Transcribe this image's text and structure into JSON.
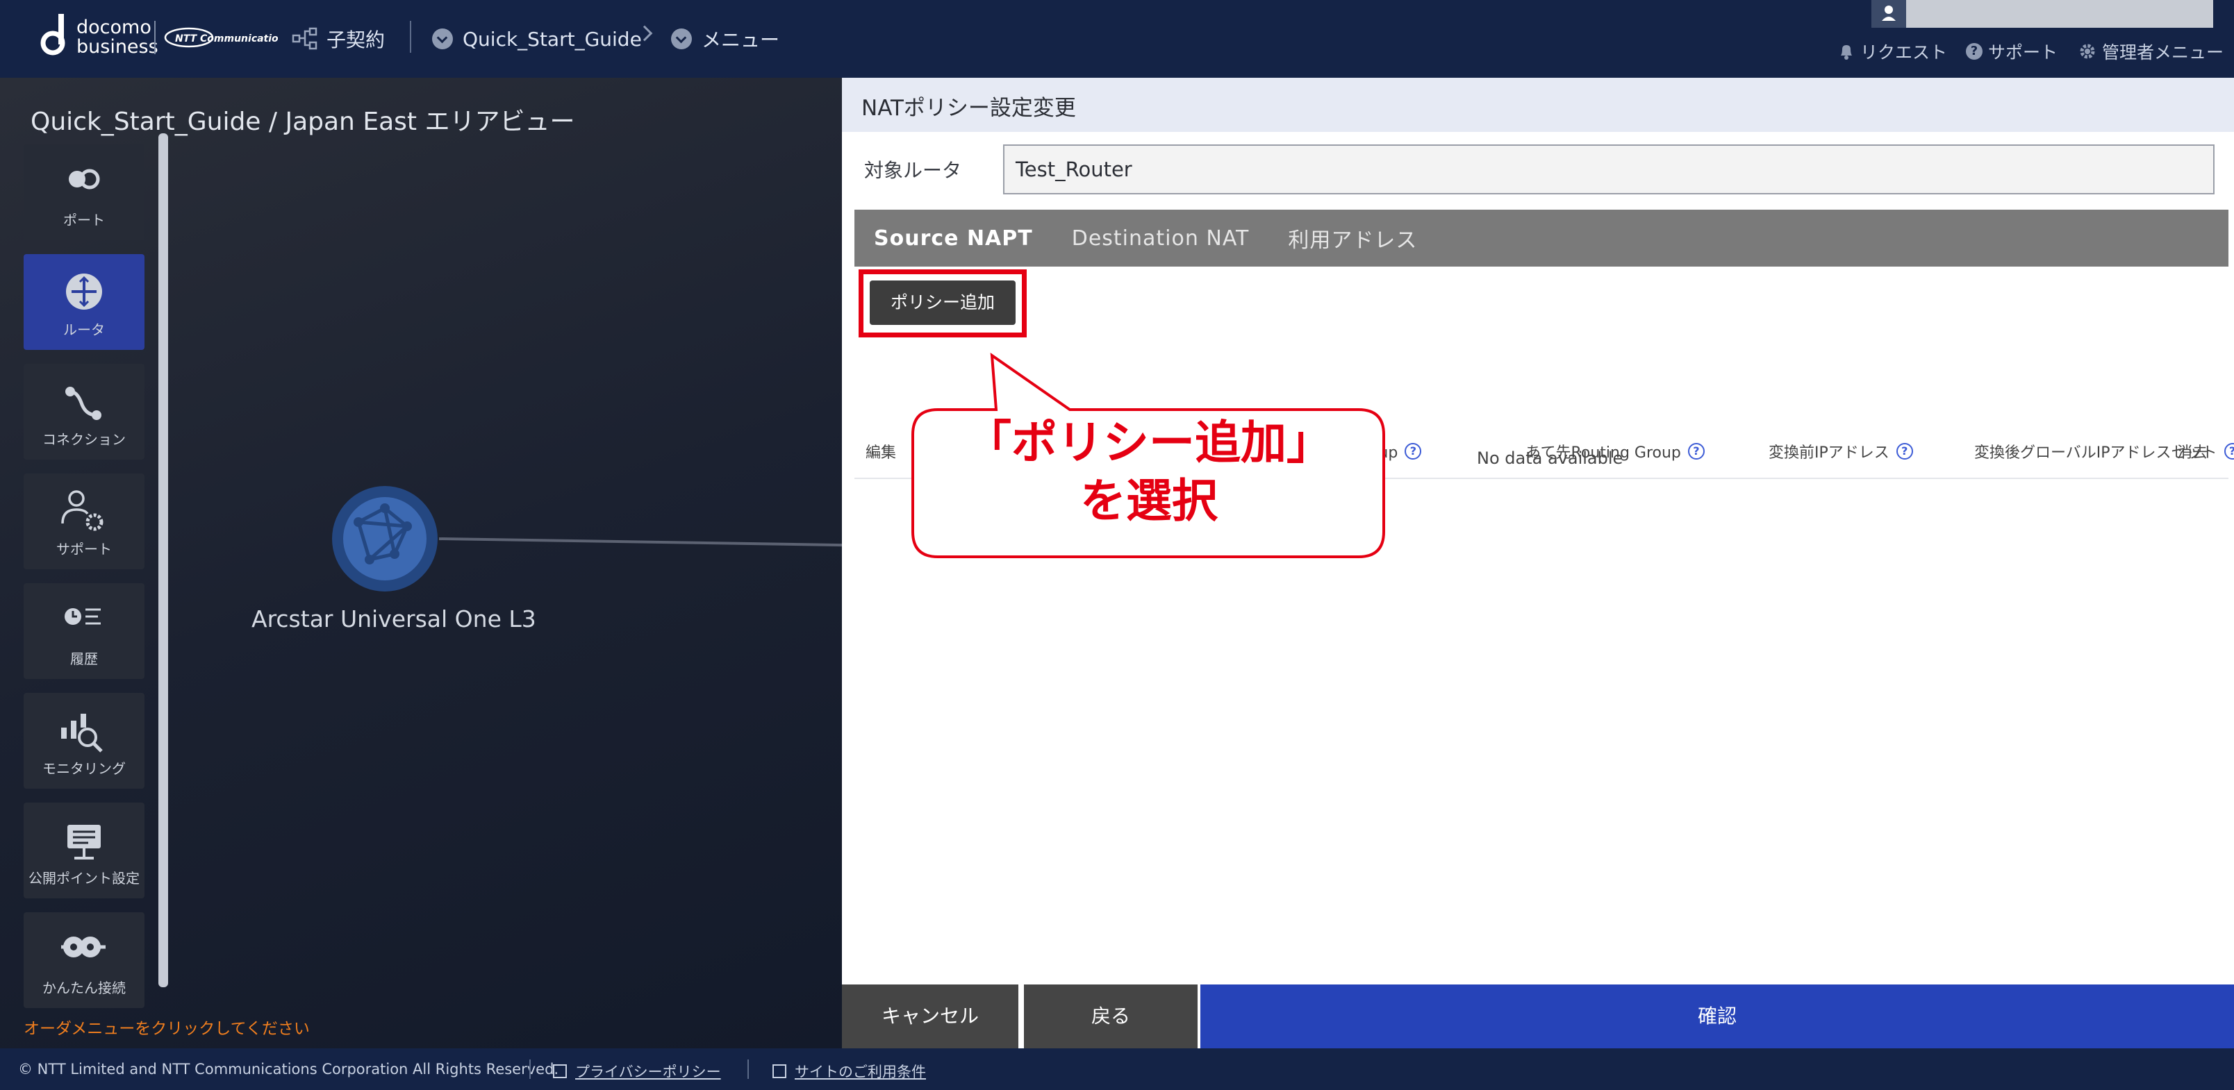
{
  "header": {
    "brand_top": "docomo",
    "brand_bottom": "business",
    "brand_ntt": "NTT Communications",
    "nav_contract": "子契約",
    "nav_guide": "Quick_Start_Guide",
    "nav_menu": "メニュー",
    "user_name": "",
    "menu_request": "リクエスト",
    "menu_support": "サポート",
    "menu_admin": "管理者メニュー"
  },
  "map": {
    "title": "Quick_Start_Guide / Japan East エリアビュー",
    "node_label": "Arcstar Universal One L3",
    "order_message": "オーダメニューをクリックしてください"
  },
  "sidebar": {
    "items": [
      {
        "label": "ポート",
        "icon": "port-icon"
      },
      {
        "label": "ルータ",
        "icon": "router-icon"
      },
      {
        "label": "コネクション",
        "icon": "connection-icon"
      },
      {
        "label": "サポート",
        "icon": "support-icon"
      },
      {
        "label": "履歴",
        "icon": "history-icon"
      },
      {
        "label": "モニタリング",
        "icon": "monitoring-icon"
      },
      {
        "label": "公開ポイント設定",
        "icon": "public-point-icon"
      },
      {
        "label": "かんたん接続",
        "icon": "easy-connect-icon"
      }
    ],
    "active_index": 1
  },
  "panel": {
    "title": "NATポリシー設定変更",
    "router_label": "対象ルータ",
    "router_value": "Test_Router",
    "tabs": [
      "Source NAPT",
      "Destination NAT",
      "利用アドレス"
    ],
    "active_tab": 0,
    "add_policy_label": "ポリシー追加",
    "table_headers": {
      "edit": "編集",
      "src_group": "送信元Routing Group",
      "dst_group": "あて先Routing Group",
      "pre_ip": "変換前IPアドレス",
      "post_ip_set": "変換後グローバルIPアドレスセット",
      "delete": "消去"
    },
    "no_data": "No data available",
    "cancel_label": "キャンセル",
    "back_label": "戻る",
    "confirm_label": "確認"
  },
  "callout": {
    "line1": "「ポリシー追加」",
    "line2": "を選択",
    "color": "#e50012"
  },
  "footer": {
    "copyright": "© NTT Limited and NTT Communications Corporation All Rights Reserved.",
    "privacy": "プライバシーポリシー",
    "terms": "サイトのご利用条件"
  },
  "colors": {
    "header_bg": "#142346",
    "accent_blue": "#2643b8",
    "active_sidebar": "#2b3e9e",
    "order_orange": "#f07e1e"
  }
}
